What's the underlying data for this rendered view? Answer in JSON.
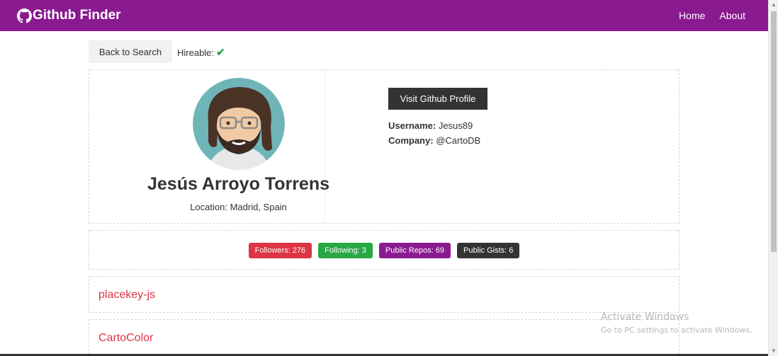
{
  "navbar": {
    "brand": "Github Finder",
    "links": [
      "Home",
      "About"
    ],
    "color": "#8a1a8f"
  },
  "actions": {
    "back_label": "Back to Search",
    "hireable_label": "Hireable:",
    "hireable_icon": "check-icon"
  },
  "profile": {
    "name": "Jesús Arroyo Torrens",
    "location": "Location: Madrid, Spain",
    "visit_label": "Visit Github Profile",
    "username_label": "Username:",
    "username": "Jesus89",
    "company_label": "Company:",
    "company": "@CartoDB"
  },
  "stats": [
    {
      "label": "Followers: 276",
      "color": "#dc3545"
    },
    {
      "label": "Following: 3",
      "color": "#28a745"
    },
    {
      "label": "Public Repos: 69",
      "color": "#8a1a8f"
    },
    {
      "label": "Public Gists: 6",
      "color": "#333333"
    }
  ],
  "repos": [
    "placekey-js",
    "CartoColor"
  ],
  "watermark": {
    "title": "Activate Windows",
    "subtitle": "Go to PC settings to activate Windows."
  }
}
